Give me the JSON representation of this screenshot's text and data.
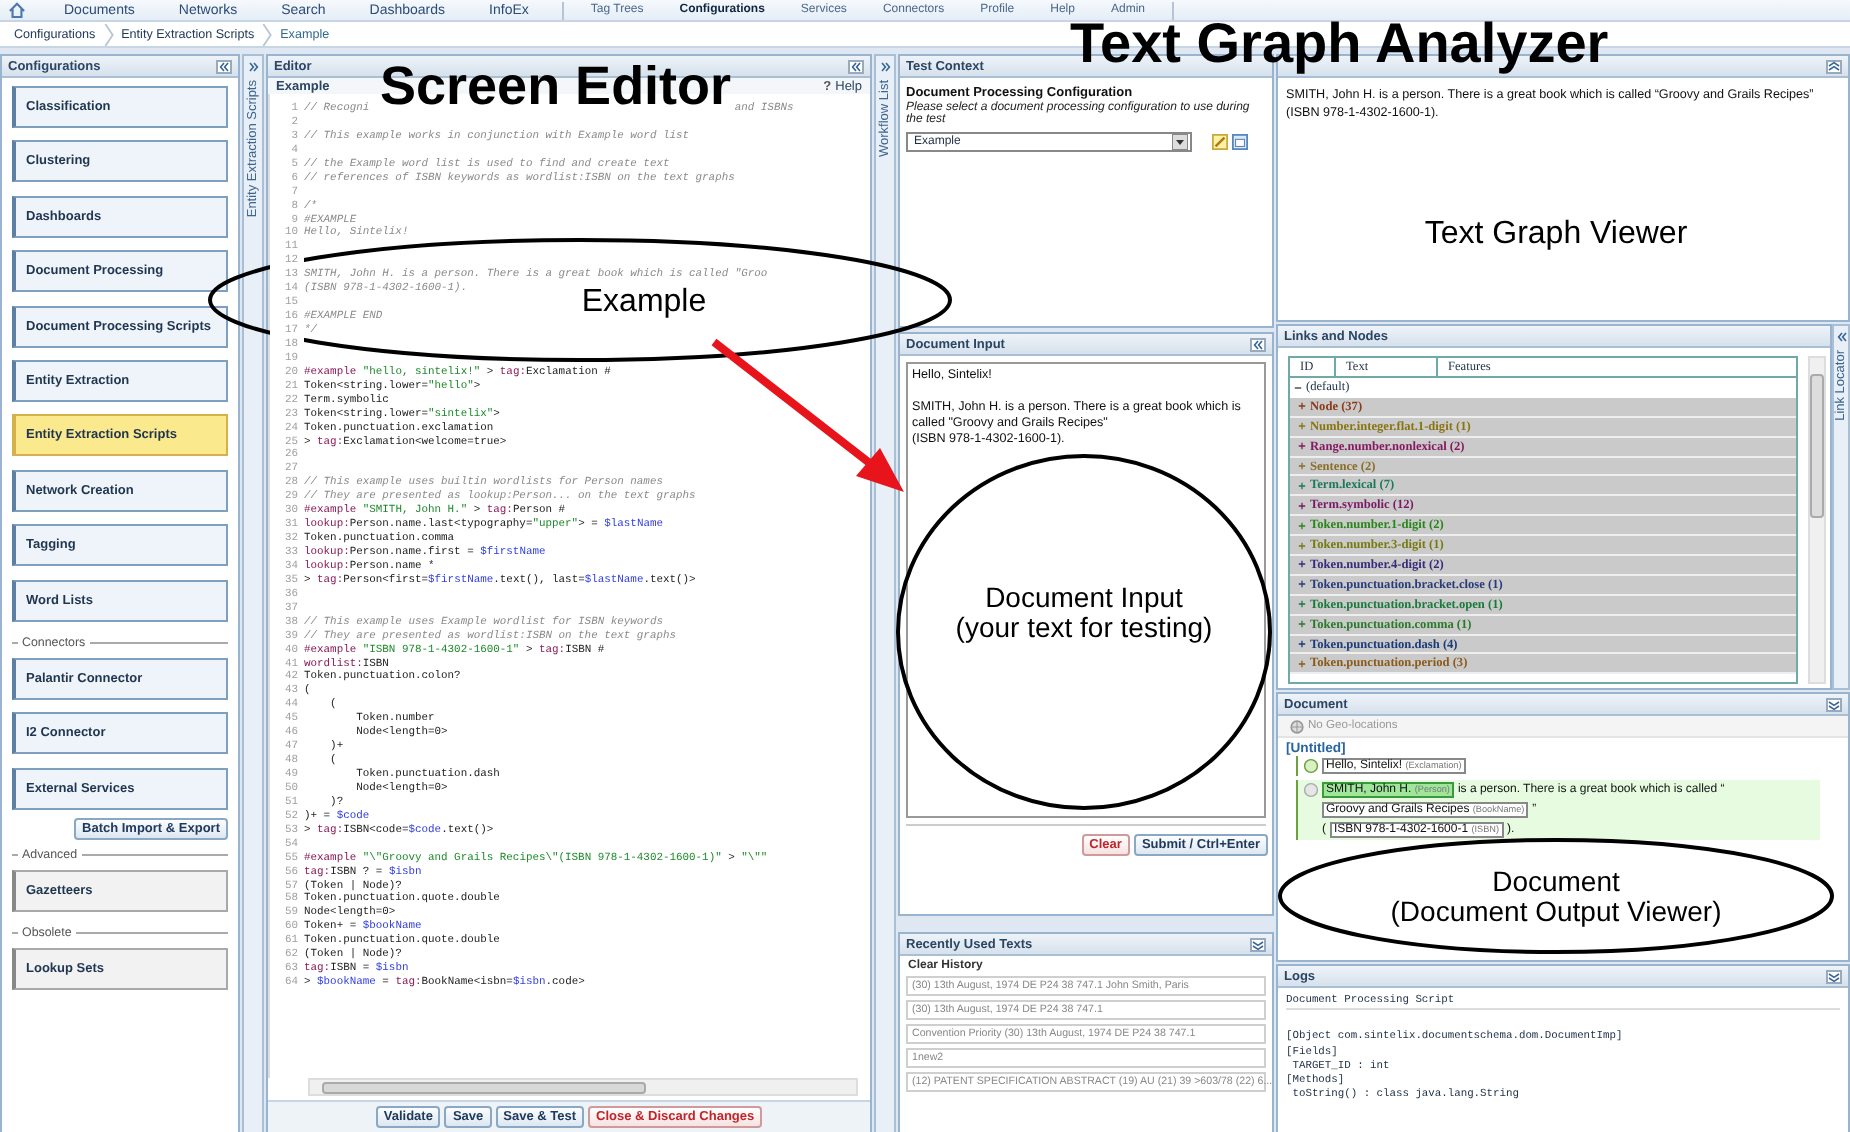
{
  "nav": {
    "primary": [
      {
        "label": "Documents",
        "selected": false
      },
      {
        "label": "Networks",
        "selected": false
      },
      {
        "label": "Search",
        "selected": false
      },
      {
        "label": "Dashboards",
        "selected": false
      },
      {
        "label": "InfoEx",
        "selected": false
      }
    ],
    "secondary": [
      {
        "label": "Tag Trees",
        "selected": false
      },
      {
        "label": "Configurations",
        "selected": true
      },
      {
        "label": "Services",
        "selected": false
      },
      {
        "label": "Connectors",
        "selected": false
      },
      {
        "label": "Profile",
        "selected": false
      },
      {
        "label": "Help",
        "selected": false
      },
      {
        "label": "Admin",
        "selected": false
      }
    ]
  },
  "breadcrumb": [
    "Configurations",
    "Entity Extraction Scripts",
    "Example"
  ],
  "sidebar": {
    "title": "Configurations",
    "strip": "Entity Extraction Scripts",
    "groups": [
      {
        "kind": "main",
        "items": [
          {
            "label": "Classification",
            "selected": false
          },
          {
            "label": "Clustering",
            "selected": false
          },
          {
            "label": "Dashboards",
            "selected": false
          },
          {
            "label": "Document Processing",
            "selected": false
          },
          {
            "label": "Document Processing Scripts",
            "selected": false
          },
          {
            "label": "Entity Extraction",
            "selected": false
          },
          {
            "label": "Entity Extraction Scripts",
            "selected": true
          },
          {
            "label": "Network Creation",
            "selected": false
          },
          {
            "label": "Tagging",
            "selected": false
          },
          {
            "label": "Word Lists",
            "selected": false
          }
        ]
      },
      {
        "kind": "main",
        "label": "Connectors",
        "items": [
          {
            "label": "Palantir Connector",
            "selected": false
          },
          {
            "label": "I2 Connector",
            "selected": false
          },
          {
            "label": "External Services",
            "selected": false
          }
        ],
        "action": "Batch Import & Export"
      },
      {
        "kind": "legacy",
        "label": "Advanced",
        "items": [
          {
            "label": "Gazetteers",
            "selected": false
          }
        ]
      },
      {
        "kind": "legacy",
        "label": "Obsolete",
        "items": [
          {
            "label": "Lookup Sets",
            "selected": false
          }
        ]
      }
    ]
  },
  "editor": {
    "title": "Editor",
    "script_name": "Example",
    "help_icon": "?",
    "help": "Help",
    "strip": "Workflow List",
    "lines": [
      {
        "n": "1",
        "code": "// Recogni                                                        and ISBNs"
      },
      {
        "n": "2"
      },
      {
        "n": "3",
        "code": "// This example works in conjunction with Example word list"
      },
      {
        "n": "4"
      },
      {
        "n": "5",
        "code": "// the Example word list is used to find and create text"
      },
      {
        "n": "6",
        "code": "// references of ISBN keywords as wordlist:ISBN on the text graphs"
      },
      {
        "n": "7"
      },
      {
        "n": "8",
        "code": "/*"
      },
      {
        "n": "9",
        "code": "#EXAMPLE"
      },
      {
        "n": "10",
        "code": "Hello, Sintelix!"
      },
      {
        "n": "11"
      },
      {
        "n": "12"
      },
      {
        "n": "13",
        "code": "SMITH, John H. is a person. There is a great book which is called \"Groo"
      },
      {
        "n": "14",
        "code": "(ISBN 978-1-4302-1600-1)."
      },
      {
        "n": "15"
      },
      {
        "n": "16",
        "code": "#EXAMPLE END"
      },
      {
        "n": "17",
        "code": "*/"
      },
      {
        "n": "18"
      },
      {
        "n": "19"
      },
      {
        "n": "20",
        "code": "#example \"hello, sintelix!\" > tag:Exclamation #"
      },
      {
        "n": "21",
        "code": "Token<string.lower=\"hello\">"
      },
      {
        "n": "22",
        "code": "Term.symbolic"
      },
      {
        "n": "23",
        "code": "Token<string.lower=\"sintelix\">"
      },
      {
        "n": "24",
        "code": "Token.punctuation.exclamation"
      },
      {
        "n": "25",
        "code": "> tag:Exclamation<welcome=true>"
      },
      {
        "n": "26"
      },
      {
        "n": "27"
      },
      {
        "n": "28",
        "code": "// This example uses builtin wordlists for Person names"
      },
      {
        "n": "29",
        "code": "// They are presented as lookup:Person... on the text graphs"
      },
      {
        "n": "30",
        "code": "#example \"SMITH, John H.\" > tag:Person #"
      },
      {
        "n": "31",
        "code": "lookup:Person.name.last<typography=\"upper\"> = $lastName"
      },
      {
        "n": "32",
        "code": "Token.punctuation.comma"
      },
      {
        "n": "33",
        "code": "lookup:Person.name.first = $firstName"
      },
      {
        "n": "34",
        "code": "lookup:Person.name *"
      },
      {
        "n": "35",
        "code": "> tag:Person<first=$firstName.text(), last=$lastName.text()>"
      },
      {
        "n": "36"
      },
      {
        "n": "37"
      },
      {
        "n": "38",
        "code": "// This example uses Example wordlist for ISBN keywords"
      },
      {
        "n": "39",
        "code": "// They are presented as wordlist:ISBN on the text graphs"
      },
      {
        "n": "40",
        "code": "#example \"ISBN 978-1-4302-1600-1\" > tag:ISBN #"
      },
      {
        "n": "41",
        "code": "wordlist:ISBN"
      },
      {
        "n": "42",
        "code": "Token.punctuation.colon?"
      },
      {
        "n": "43",
        "code": "("
      },
      {
        "n": "44",
        "code": "    ("
      },
      {
        "n": "45",
        "code": "        Token.number"
      },
      {
        "n": "46",
        "code": "        Node<length=0>"
      },
      {
        "n": "47",
        "code": "    )+"
      },
      {
        "n": "48",
        "code": "    ("
      },
      {
        "n": "49",
        "code": "        Token.punctuation.dash"
      },
      {
        "n": "50",
        "code": "        Node<length=0>"
      },
      {
        "n": "51",
        "code": "    )?"
      },
      {
        "n": "52",
        "code": ")+ = $code"
      },
      {
        "n": "53",
        "code": "> tag:ISBN<code=$code.text()>"
      },
      {
        "n": "54"
      },
      {
        "n": "55",
        "code": "#example \"\\\"Groovy and Grails Recipes\\\"(ISBN 978-1-4302-1600-1)\" > \"\\\"\""
      },
      {
        "n": "56",
        "code": "tag:ISBN ? = $isbn"
      },
      {
        "n": "57",
        "code": "(Token | Node)?"
      },
      {
        "n": "58",
        "code": "Token.punctuation.quote.double"
      },
      {
        "n": "59",
        "code": "Node<length=0>"
      },
      {
        "n": "60",
        "code": "Token+ = $bookName"
      },
      {
        "n": "61",
        "code": "Token.punctuation.quote.double"
      },
      {
        "n": "62",
        "code": "(Token | Node)?"
      },
      {
        "n": "63",
        "code": "tag:ISBN = $isbn"
      },
      {
        "n": "64",
        "code": "> $bookName = tag:BookName<isbn=$isbn.code>"
      }
    ],
    "buttons": [
      {
        "label": "Validate",
        "kind": "normal"
      },
      {
        "label": "Save",
        "kind": "normal"
      },
      {
        "label": "Save & Test",
        "kind": "normal"
      },
      {
        "label": "Close & Discard Changes",
        "kind": "danger"
      }
    ]
  },
  "test_context": {
    "title": "Test Context",
    "heading": "Document Processing Configuration",
    "hint": "Please select a document processing configuration to use during the test",
    "select": "Example"
  },
  "document_input": {
    "title": "Document Input",
    "value": "Hello, Sintelix!\n\nSMITH, John H. is a person. There is a great book which is called \"Groovy and Grails Recipes\"\n(ISBN 978-1-4302-1600-1).",
    "buttons": [
      {
        "label": "Clear",
        "kind": "danger"
      },
      {
        "label": "Submit / Ctrl+Enter",
        "kind": "normal"
      }
    ]
  },
  "recent": {
    "title": "Recently Used Texts",
    "clear": "Clear History",
    "items": [
      "(30) 13th August, 1974 DE P24 38 747.1 John Smith, Paris",
      "(30) 13th August, 1974 DE P24 38 747.1",
      "Convention Priority (30) 13th August, 1974 DE P24 38 747.1",
      "1new2",
      "(12) PATENT SPECIFICATION ABSTRACT (19) AU (21) 39 >603/78 (22) 6..."
    ]
  },
  "viewer": {
    "text": "SMITH, John H. is a person. There is a great book which is called “Groovy and Grails Recipes”\n(ISBN 978-1-4302-1600-1)."
  },
  "links_nodes": {
    "title": "Links and Nodes",
    "strip": "Link Locator",
    "columns": [
      "ID",
      "Text",
      "Features"
    ],
    "tree": [
      {
        "label": "(default)",
        "expanded": true,
        "children": [
          {
            "label": "Node (37)",
            "expanded": false,
            "color": "#8b3a1a"
          },
          {
            "label": "Number.integer.flat.1-digit (1)",
            "expanded": false,
            "color": "#8a7410"
          },
          {
            "label": "Range.number.nonlexical (2)",
            "expanded": false,
            "color": "#861a62"
          },
          {
            "label": "Sentence (2)",
            "expanded": false,
            "color": "#8a6e2a"
          },
          {
            "label": "Term.lexical (7)",
            "expanded": false,
            "color": "#1a7a5a"
          },
          {
            "label": "Term.symbolic (12)",
            "expanded": false,
            "color": "#7a1a66"
          },
          {
            "label": "Token.number.1-digit (2)",
            "expanded": false,
            "color": "#2a861a"
          },
          {
            "label": "Token.number.3-digit (1)",
            "expanded": false,
            "color": "#767a10"
          },
          {
            "label": "Token.number.4-digit (2)",
            "expanded": false,
            "color": "#3a2a7a"
          },
          {
            "label": "Token.punctuation.bracket.close (1)",
            "expanded": false,
            "color": "#2a3a7a"
          },
          {
            "label": "Token.punctuation.bracket.open (1)",
            "expanded": false,
            "color": "#1a7a3a"
          },
          {
            "label": "Token.punctuation.comma (1)",
            "expanded": false,
            "color": "#2a7a2a"
          },
          {
            "label": "Token.punctuation.dash (4)",
            "expanded": false,
            "color": "#1a3a7a"
          },
          {
            "label": "Token.punctuation.period (3)",
            "expanded": false,
            "color": "#8a5a1a"
          }
        ]
      }
    ]
  },
  "document": {
    "title": "Document",
    "geo": "No Geo-locations",
    "doc_title": "[Untitled]",
    "sentences": [
      {
        "highlighted": false,
        "lines": [
          [
            {
              "text": "Hello, Sintelix!",
              "tag": "(Exclamation)",
              "kind": "entity"
            }
          ]
        ]
      },
      {
        "highlighted": true,
        "lines": [
          [
            {
              "text": "SMITH, John H.",
              "tag": "(Person)",
              "kind": "person"
            },
            {
              "text": "is a person. There is a great book which is called “",
              "kind": "plain"
            }
          ],
          [
            {
              "text": "Groovy and Grails Recipes",
              "tag": "(BookName)",
              "kind": "entity"
            },
            {
              "text": "”",
              "kind": "plain"
            }
          ],
          [
            {
              "text": "(",
              "kind": "plain"
            },
            {
              "text": "ISBN 978-1-4302-1600-1",
              "tag": "(ISBN)",
              "kind": "entity"
            },
            {
              "text": ").",
              "kind": "plain"
            }
          ]
        ]
      }
    ]
  },
  "logs": {
    "title": "Logs",
    "heading": "Document Processing Script",
    "lines": [
      "[Object com.sintelix.documentschema.dom.DocumentImp]",
      "[Fields]",
      " TARGET_ID : int",
      "[Methods]",
      " toString() : class java.lang.String"
    ]
  },
  "annotations": {
    "titles": [
      {
        "text": "Screen Editor",
        "kind": "editor"
      },
      {
        "text": "Text Graph Analyzer",
        "kind": "analyzer"
      }
    ],
    "callouts": [
      {
        "text": "Example",
        "kind": "example"
      },
      {
        "text": "Document Input\n(your text for testing)",
        "kind": "input"
      },
      {
        "text": "Text Graph Viewer",
        "kind": "viewer"
      },
      {
        "text": "Document\n(Document Output Viewer)",
        "kind": "output"
      }
    ],
    "arrow": true
  }
}
